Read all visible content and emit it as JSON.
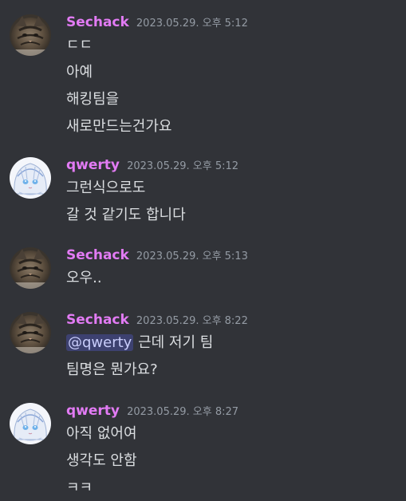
{
  "messages": [
    {
      "author": "Sechack",
      "timestamp": "2023.05.29. 오후 5:12",
      "avatar": "cat-avatar",
      "lines": [
        "ㄷㄷ",
        "아예",
        "해킹팀을",
        "새로만드는건가요"
      ]
    },
    {
      "author": "qwerty",
      "timestamp": "2023.05.29. 오후 5:12",
      "avatar": "anime-girl-avatar",
      "lines": [
        "그런식으로도",
        "갈 것 같기도 합니다"
      ]
    },
    {
      "author": "Sechack",
      "timestamp": "2023.05.29. 오후 5:13",
      "avatar": "cat-avatar",
      "lines": [
        "오우.."
      ]
    },
    {
      "author": "Sechack",
      "timestamp": "2023.05.29. 오후 8:22",
      "avatar": "cat-avatar",
      "mention": "@qwerty",
      "lines": [
        "근데 저기 팀",
        "팀명은 뭔가요?"
      ]
    },
    {
      "author": "qwerty",
      "timestamp": "2023.05.29. 오후 8:27",
      "avatar": "anime-girl-avatar",
      "lines": [
        "아직 없어여",
        "생각도 안함",
        "ㅋㅋ"
      ]
    }
  ],
  "colors": {
    "background": "#313338",
    "username": "#e27bf4",
    "text": "#dbdee1",
    "timestamp": "#949ba4",
    "mention_bg": "#3c4270"
  }
}
